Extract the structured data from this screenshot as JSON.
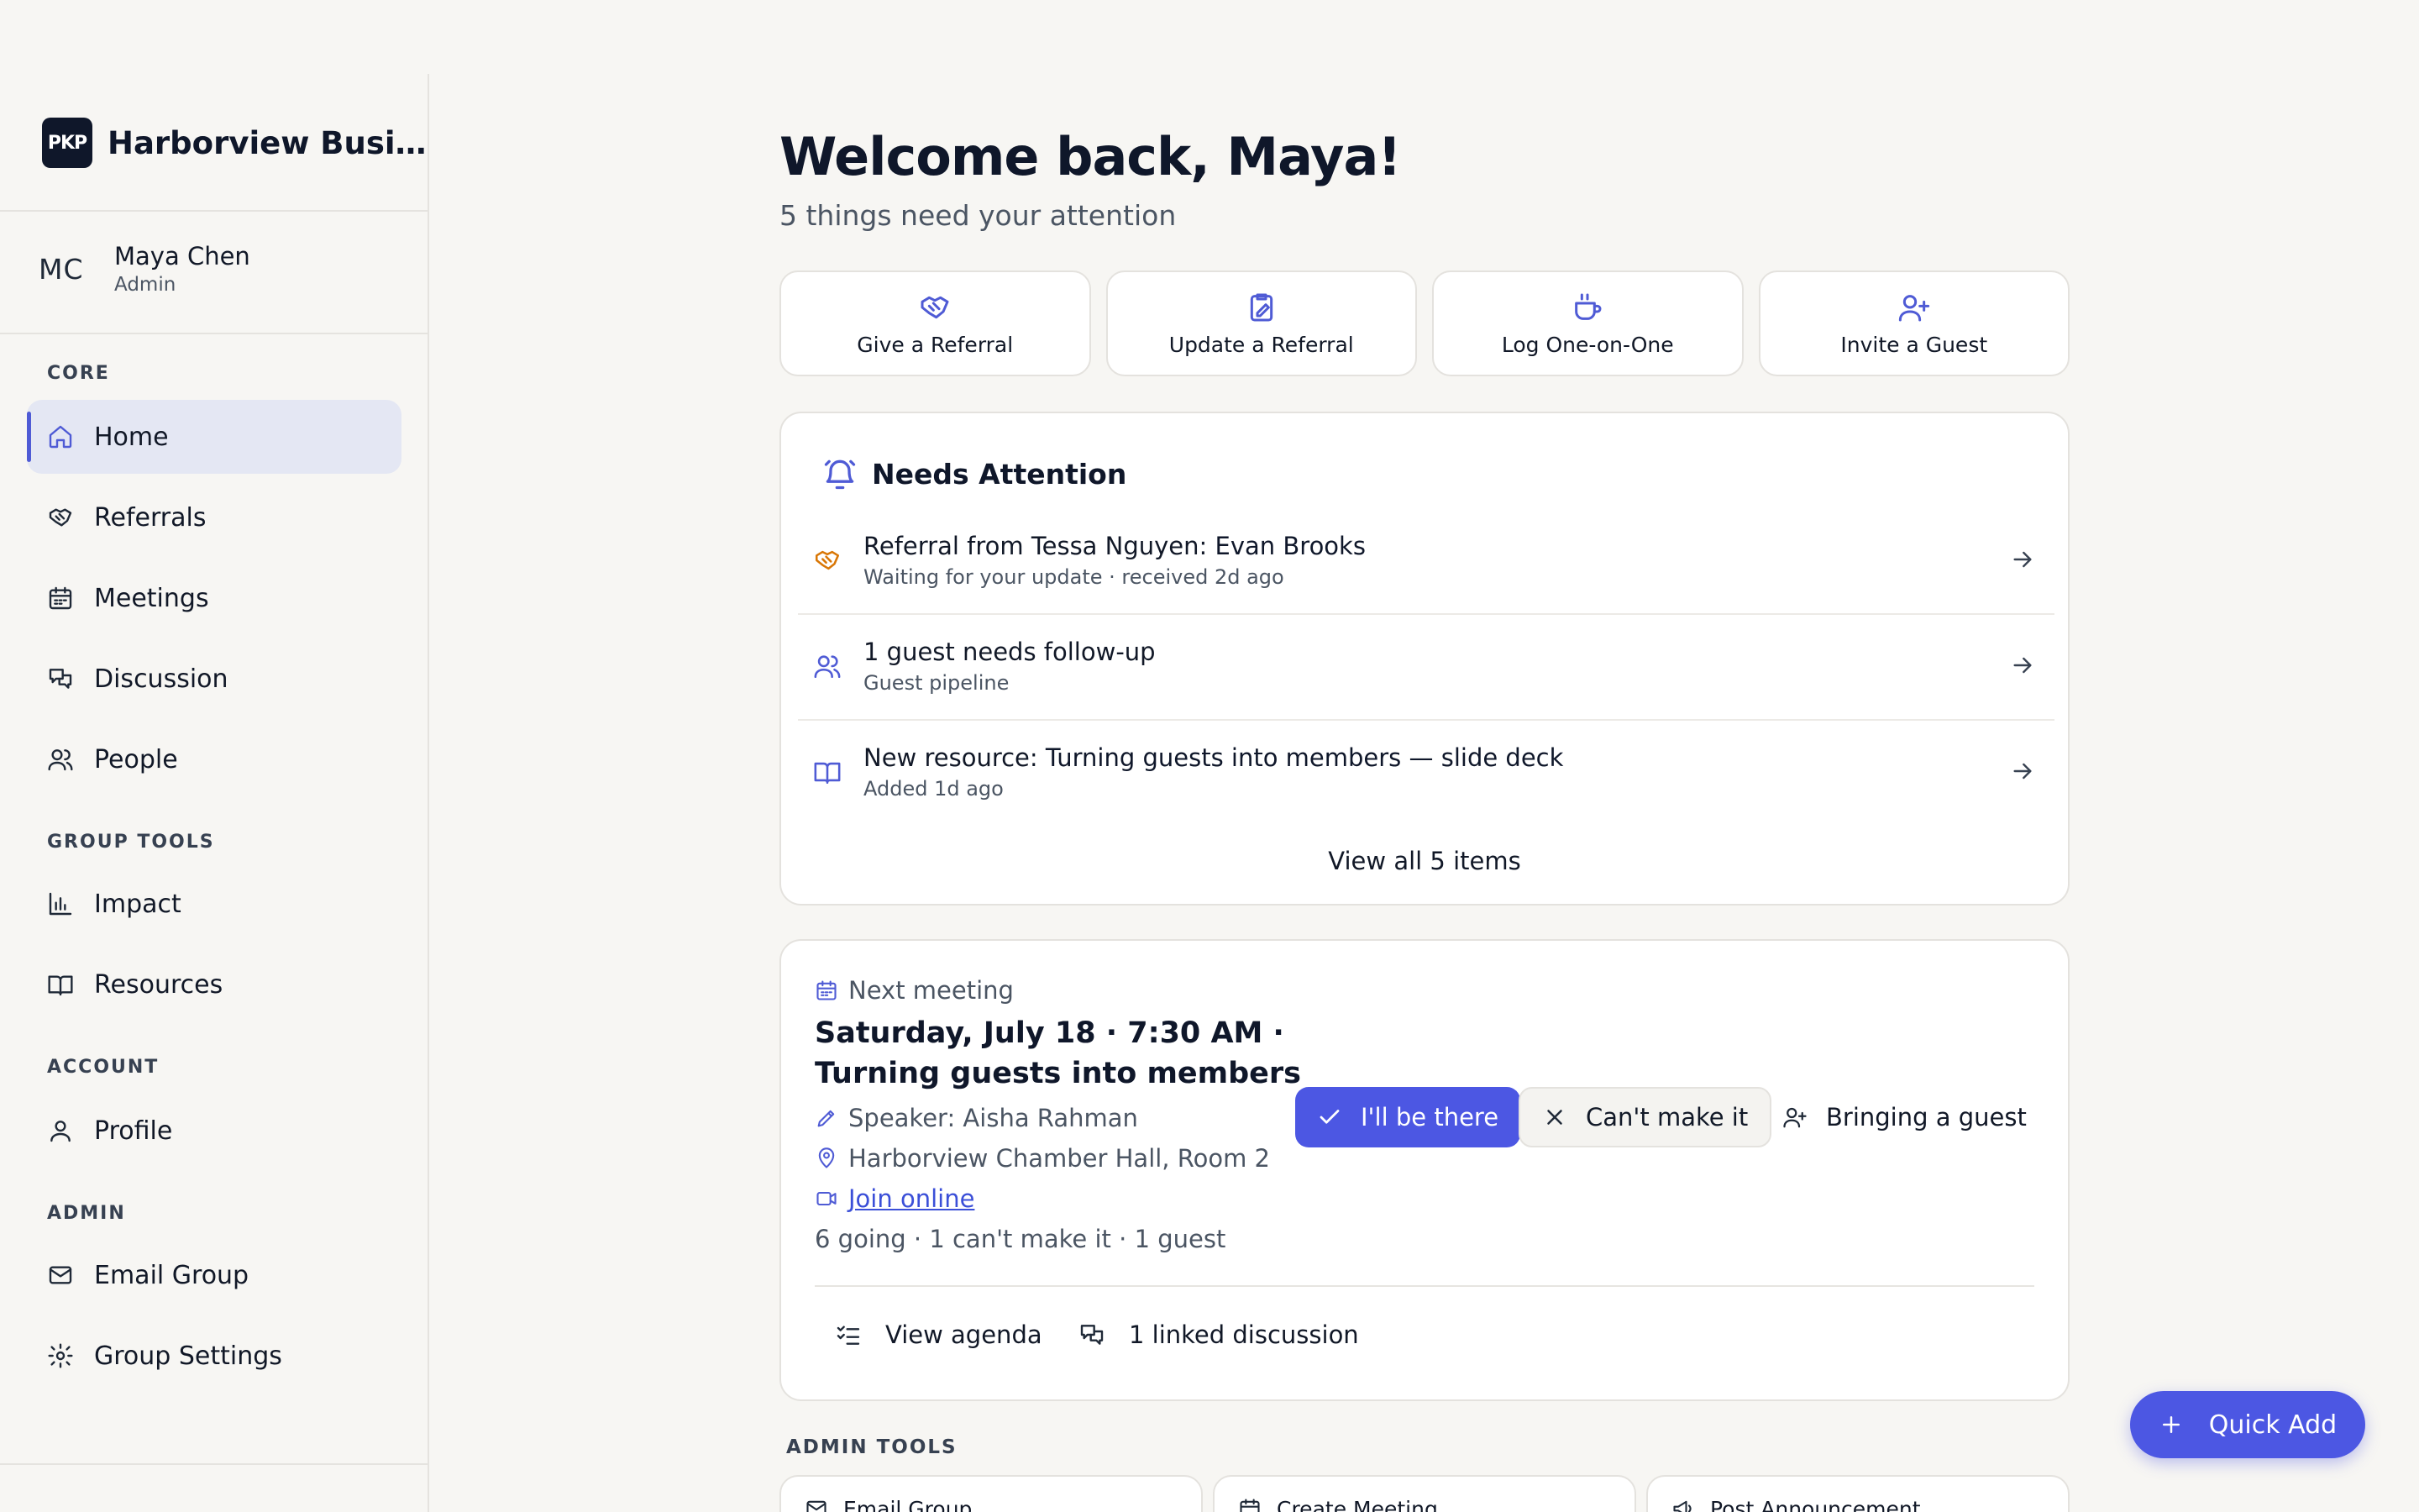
{
  "brand": {
    "logo_text": "PKP",
    "name": "Harborview Busi…"
  },
  "user": {
    "initials": "MC",
    "name": "Maya Chen",
    "role": "Admin"
  },
  "nav": {
    "core_label": "CORE",
    "home": "Home",
    "referrals": "Referrals",
    "meetings": "Meetings",
    "discussion": "Discussion",
    "people": "People",
    "group_tools_label": "GROUP TOOLS",
    "impact": "Impact",
    "resources": "Resources",
    "account_label": "ACCOUNT",
    "profile": "Profile",
    "admin_label": "ADMIN",
    "email_group": "Email Group",
    "group_settings": "Group Settings"
  },
  "header": {
    "title": "Welcome back, Maya!",
    "subtitle": "5 things need your attention"
  },
  "quick_actions": {
    "give_referral": "Give a Referral",
    "update_referral": "Update a Referral",
    "log_one_on_one": "Log One-on-One",
    "invite_guest": "Invite a Guest"
  },
  "needs_attention": {
    "title": "Needs Attention",
    "items": [
      {
        "title_prefix": "Referral from Tessa Nguyen: ",
        "title_emph": "Evan Brooks",
        "subtitle": "Waiting for your update · received 2d ago"
      },
      {
        "title_prefix": "1 guest needs follow-up",
        "title_emph": "",
        "subtitle": "Guest pipeline"
      },
      {
        "title_prefix": "New resource: ",
        "title_emph": "Turning guests into members — slide deck",
        "subtitle": "Added 1d ago"
      }
    ],
    "view_all": "View all 5 items"
  },
  "next_meeting": {
    "label": "Next meeting",
    "title": "Saturday, July 18 · 7:30 AM · Turning guests into members",
    "speaker": "Speaker: Aisha Rahman",
    "location": "Harborview Chamber Hall, Room 2",
    "join": "Join online",
    "rsvp_counts": "6 going · 1 can't make it · 1 guest",
    "rsvp_yes": "I'll be there",
    "rsvp_no": "Can't make it",
    "rsvp_guest": "Bringing a guest",
    "view_agenda": "View agenda",
    "linked_discussion": "1 linked discussion"
  },
  "admin_tools": {
    "label": "ADMIN TOOLS",
    "cards": [
      "Email Group",
      "Create Meeting",
      "Post Announcement"
    ]
  },
  "quick_add": "Quick Add",
  "colors": {
    "accent": "#4c57e3",
    "referral_icon": "#d97706",
    "background": "#f7f6f3"
  }
}
